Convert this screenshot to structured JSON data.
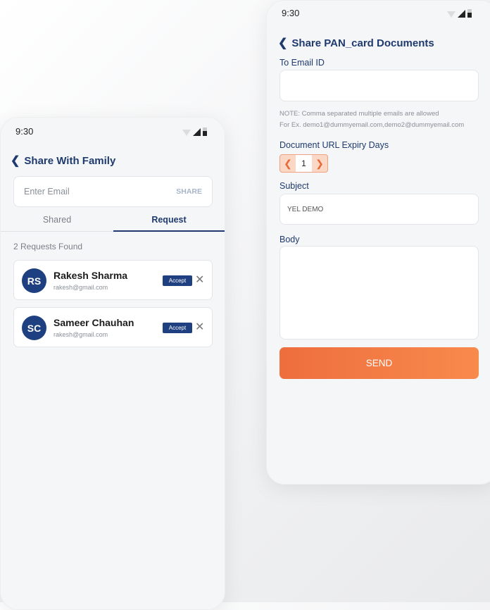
{
  "family_screen": {
    "status_time": "9:30",
    "title": "Share With Family",
    "email_placeholder": "Enter Email",
    "share_label": "SHARE",
    "tabs": [
      {
        "label": "Shared",
        "active": false
      },
      {
        "label": "Request",
        "active": true
      }
    ],
    "results_text": "2 Requests Found",
    "requests": [
      {
        "initials": "RS",
        "name": "Rakesh Sharma",
        "email": "rakesh@gmail.com",
        "accept_label": "Accept"
      },
      {
        "initials": "SC",
        "name": "Sameer Chauhan",
        "email": "rakesh@gmail.com",
        "accept_label": "Accept"
      }
    ]
  },
  "share_doc_screen": {
    "status_time": "9:30",
    "title": "Share PAN_card Documents",
    "to_email_label": "To Email ID",
    "to_email_value": "",
    "note_line1": "NOTE: Comma separated multiple emails are allowed",
    "note_line2": "For Ex. demo1@dummyemail.com,demo2@dummyemail.com",
    "expiry_label": "Document URL Expiry Days",
    "expiry_value": "1",
    "subject_label": "Subject",
    "subject_value": "YEL DEMO",
    "body_label": "Body",
    "body_value": "",
    "send_label": "SEND"
  },
  "colors": {
    "primary": "#1e3f80",
    "accent": "#f47a45"
  }
}
